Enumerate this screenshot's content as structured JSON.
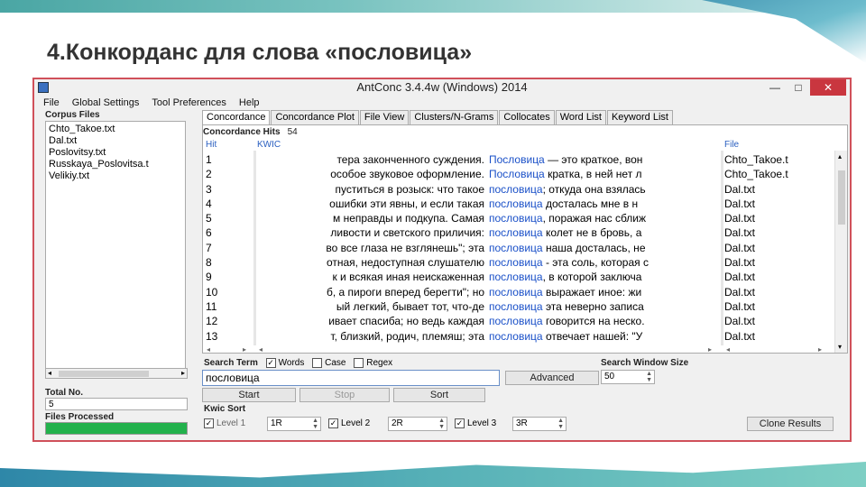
{
  "slide": {
    "title": "4.Конкорданс для слова «пословица»"
  },
  "window": {
    "title": "AntConc 3.4.4w (Windows) 2014",
    "minimize": "—",
    "maximize": "□",
    "close": "✕"
  },
  "menu": [
    "File",
    "Global Settings",
    "Tool Preferences",
    "Help"
  ],
  "left": {
    "corpus_label": "Corpus Files",
    "files": [
      "Chto_Takoe.txt",
      "Dal.txt",
      "Poslovitsy.txt",
      "Russkaya_Poslovitsa.t",
      "Velikiy.txt"
    ],
    "total_label": "Total No.",
    "total_value": "5",
    "processed_label": "Files Processed",
    "progress": 1.0
  },
  "tabs": [
    "Concordance",
    "Concordance Plot",
    "File View",
    "Clusters/N-Grams",
    "Collocates",
    "Word List",
    "Keyword List"
  ],
  "active_tab": "Concordance",
  "concordance": {
    "hits_label": "Concordance Hits",
    "hits_value": "54",
    "col_hit": "Hit",
    "col_kwic": "KWIC",
    "col_file": "File",
    "rows": [
      {
        "hit": "1",
        "left": "тера законченного суждения.",
        "kw": "Пословица",
        "right": " — это краткое, вон",
        "file": "Chto_Takoe.t"
      },
      {
        "hit": "2",
        "left": "особое звуковое оформление.",
        "kw": "Пословица",
        "right": " кратка, в ней нет л",
        "file": "Chto_Takoe.t"
      },
      {
        "hit": "3",
        "left": "пуститься в розыск: что такое",
        "kw": "пословица",
        "right": "; откуда она взялась",
        "file": "Dal.txt"
      },
      {
        "hit": "4",
        "left": "ошибки эти явны, и если такая",
        "kw": "пословица",
        "right": " досталась мне в н",
        "file": "Dal.txt"
      },
      {
        "hit": "5",
        "left": "м неправды и подкупа. Самая",
        "kw": "пословица",
        "right": ", поражая нас сближ",
        "file": "Dal.txt"
      },
      {
        "hit": "6",
        "left": "ливости и светского приличия:",
        "kw": "пословица",
        "right": " колет не в бровь, а",
        "file": "Dal.txt"
      },
      {
        "hit": "7",
        "left": "во все глаза не взглянешь\"; эта",
        "kw": "пословица",
        "right": " наша досталась, не",
        "file": "Dal.txt"
      },
      {
        "hit": "8",
        "left": "отная, недоступная слушателю",
        "kw": "пословица",
        "right": " - эта соль, которая с",
        "file": "Dal.txt"
      },
      {
        "hit": "9",
        "left": "к и всякая иная неискаженная",
        "kw": "пословица",
        "right": ", в которой заключа",
        "file": "Dal.txt"
      },
      {
        "hit": "10",
        "left": "б, а пироги вперед берегти\"; но",
        "kw": "пословица",
        "right": " выражает иное: жи",
        "file": "Dal.txt"
      },
      {
        "hit": "11",
        "left": "ый легкий, бывает тот, что-де",
        "kw": "пословица",
        "right": " эта неверно записа",
        "file": "Dal.txt"
      },
      {
        "hit": "12",
        "left": "ивает спасиба; но ведь каждая",
        "kw": "пословица",
        "right": " говорится на неско.",
        "file": "Dal.txt"
      },
      {
        "hit": "13",
        "left": "т, близкий, родич, племяш; эта",
        "kw": "пословица",
        "right": " отвечает нашей: \"У",
        "file": "Dal.txt"
      }
    ]
  },
  "controls": {
    "search_term_label": "Search Term",
    "words_label": "Words",
    "case_label": "Case",
    "regex_label": "Regex",
    "search_value": "пословица",
    "advanced_label": "Advanced",
    "window_size_label": "Search Window Size",
    "window_size_value": "50",
    "start_label": "Start",
    "stop_label": "Stop",
    "sort_label": "Sort",
    "kwic_sort_label": "Kwic Sort",
    "level1_label": "Level 1",
    "level1_value": "1R",
    "level2_label": "Level 2",
    "level2_value": "2R",
    "level3_label": "Level 3",
    "level3_value": "3R",
    "clone_label": "Clone Results",
    "check_mark": "✓"
  }
}
